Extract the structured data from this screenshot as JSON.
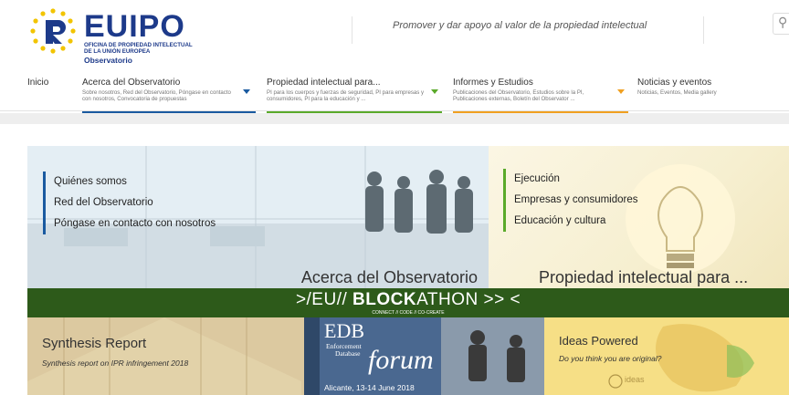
{
  "header": {
    "logo_word": "EUIPO",
    "logo_line1": "OFICINA DE PROPIEDAD INTELECTUAL",
    "logo_line2": "DE LA UNIÓN EUROPEA",
    "logo_line3": "Observatorio",
    "tagline": "Promover y dar apoyo al valor de la propiedad intelectual",
    "search_icon": "search-icon"
  },
  "nav": {
    "items": [
      {
        "title": "Inicio",
        "sub": "",
        "color": "#ffffff"
      },
      {
        "title": "Acerca del Observatorio",
        "sub": "Sobre nosotros, Red del Observatorio, Póngase en contacto con nosotros, Convocatoria de propuestas",
        "color": "#1a5aa0"
      },
      {
        "title": "Propiedad intelectual para...",
        "sub": "PI para los cuerpos y fuerzas de seguridad, PI para empresas y consumidores, PI para la educación y ...",
        "color": "#5aaa2a"
      },
      {
        "title": "Informes y Estudios",
        "sub": "Publicaciones del Observatorio, Estudios sobre la PI, Publicaciones externas, Boletín del Observator ...",
        "color": "#f0a020"
      },
      {
        "title": "Noticias y eventos",
        "sub": "Noticias, Eventos, Media gallery",
        "color": "#ffffff"
      }
    ]
  },
  "tiles": {
    "about": {
      "links": [
        "Quiénes somos",
        "Red del Observatorio",
        "Póngase en contacto con nosotros"
      ],
      "title": "Acerca del Observatorio"
    },
    "ip": {
      "links": [
        "Ejecución",
        "Empresas y consumidores",
        "Educación y cultura"
      ],
      "title": "Propiedad intelectual para ..."
    },
    "blockathon": {
      "main_prefix": ">/EU// ",
      "main_bold": "BLOCK",
      "main_suffix": "ATHON >> <",
      "sub": "CONNECT // CODE // CO-CREATE"
    },
    "synthesis": {
      "title": "Synthesis Report",
      "subtitle": "Synthesis report on IPR infringement 2018"
    },
    "edb": {
      "title": "EDB",
      "line1": "Enforcement",
      "line2": "Database",
      "forum": "forum",
      "date": "Alicante, 13-14 June 2018"
    },
    "ideas": {
      "title": "Ideas Powered",
      "subtitle": "Do you think you are original?",
      "logo": "ideas"
    }
  },
  "colors": {
    "brand_blue": "#1d3a8a",
    "star_yellow": "#f2c400",
    "blockathon_green": "#2d5a1a"
  }
}
